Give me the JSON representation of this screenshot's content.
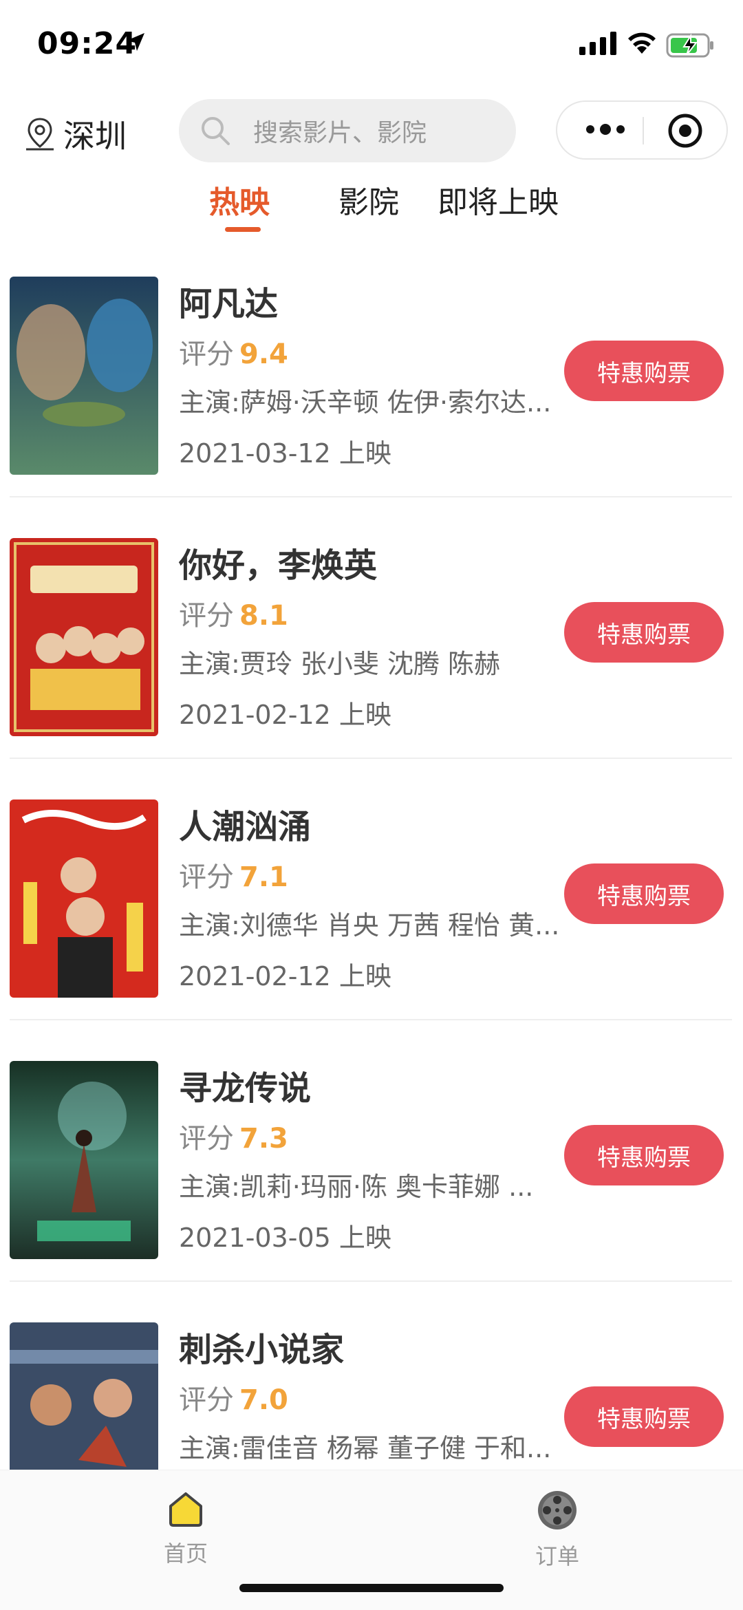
{
  "status_bar": {
    "time": "09:24"
  },
  "header": {
    "city": "深圳",
    "search_placeholder": "搜索影片、影院"
  },
  "tabs": [
    {
      "label": "热映",
      "active": true
    },
    {
      "label": "影院",
      "active": false
    },
    {
      "label": "即将上映",
      "active": false
    }
  ],
  "rating_label": "评分",
  "buy_label": "特惠购票",
  "movies": [
    {
      "title": "阿凡达",
      "rating": "9.4",
      "cast": "主演:萨姆·沃辛顿 佐伊·索尔达...",
      "release": "2021-03-12 上映",
      "poster_color": "#2e5a78"
    },
    {
      "title": "你好，李焕英",
      "rating": "8.1",
      "cast": "主演:贾玲 张小斐 沈腾 陈赫",
      "release": "2021-02-12 上映",
      "poster_color": "#c8261e"
    },
    {
      "title": "人潮汹涌",
      "rating": "7.1",
      "cast": "主演:刘德华 肖央 万茜 程怡 黄...",
      "release": "2021-02-12 上映",
      "poster_color": "#d42a1e"
    },
    {
      "title": "寻龙传说",
      "rating": "7.3",
      "cast": "主演:凯莉·玛丽·陈 奥卡菲娜 ...",
      "release": "2021-03-05 上映",
      "poster_color": "#2b4a3a"
    },
    {
      "title": "刺杀小说家",
      "rating": "7.0",
      "cast": "主演:雷佳音 杨幂 董子健 于和...",
      "release": "",
      "poster_color": "#3b4c66"
    }
  ],
  "tabbar": {
    "home_label": "首页",
    "orders_label": "订单"
  }
}
